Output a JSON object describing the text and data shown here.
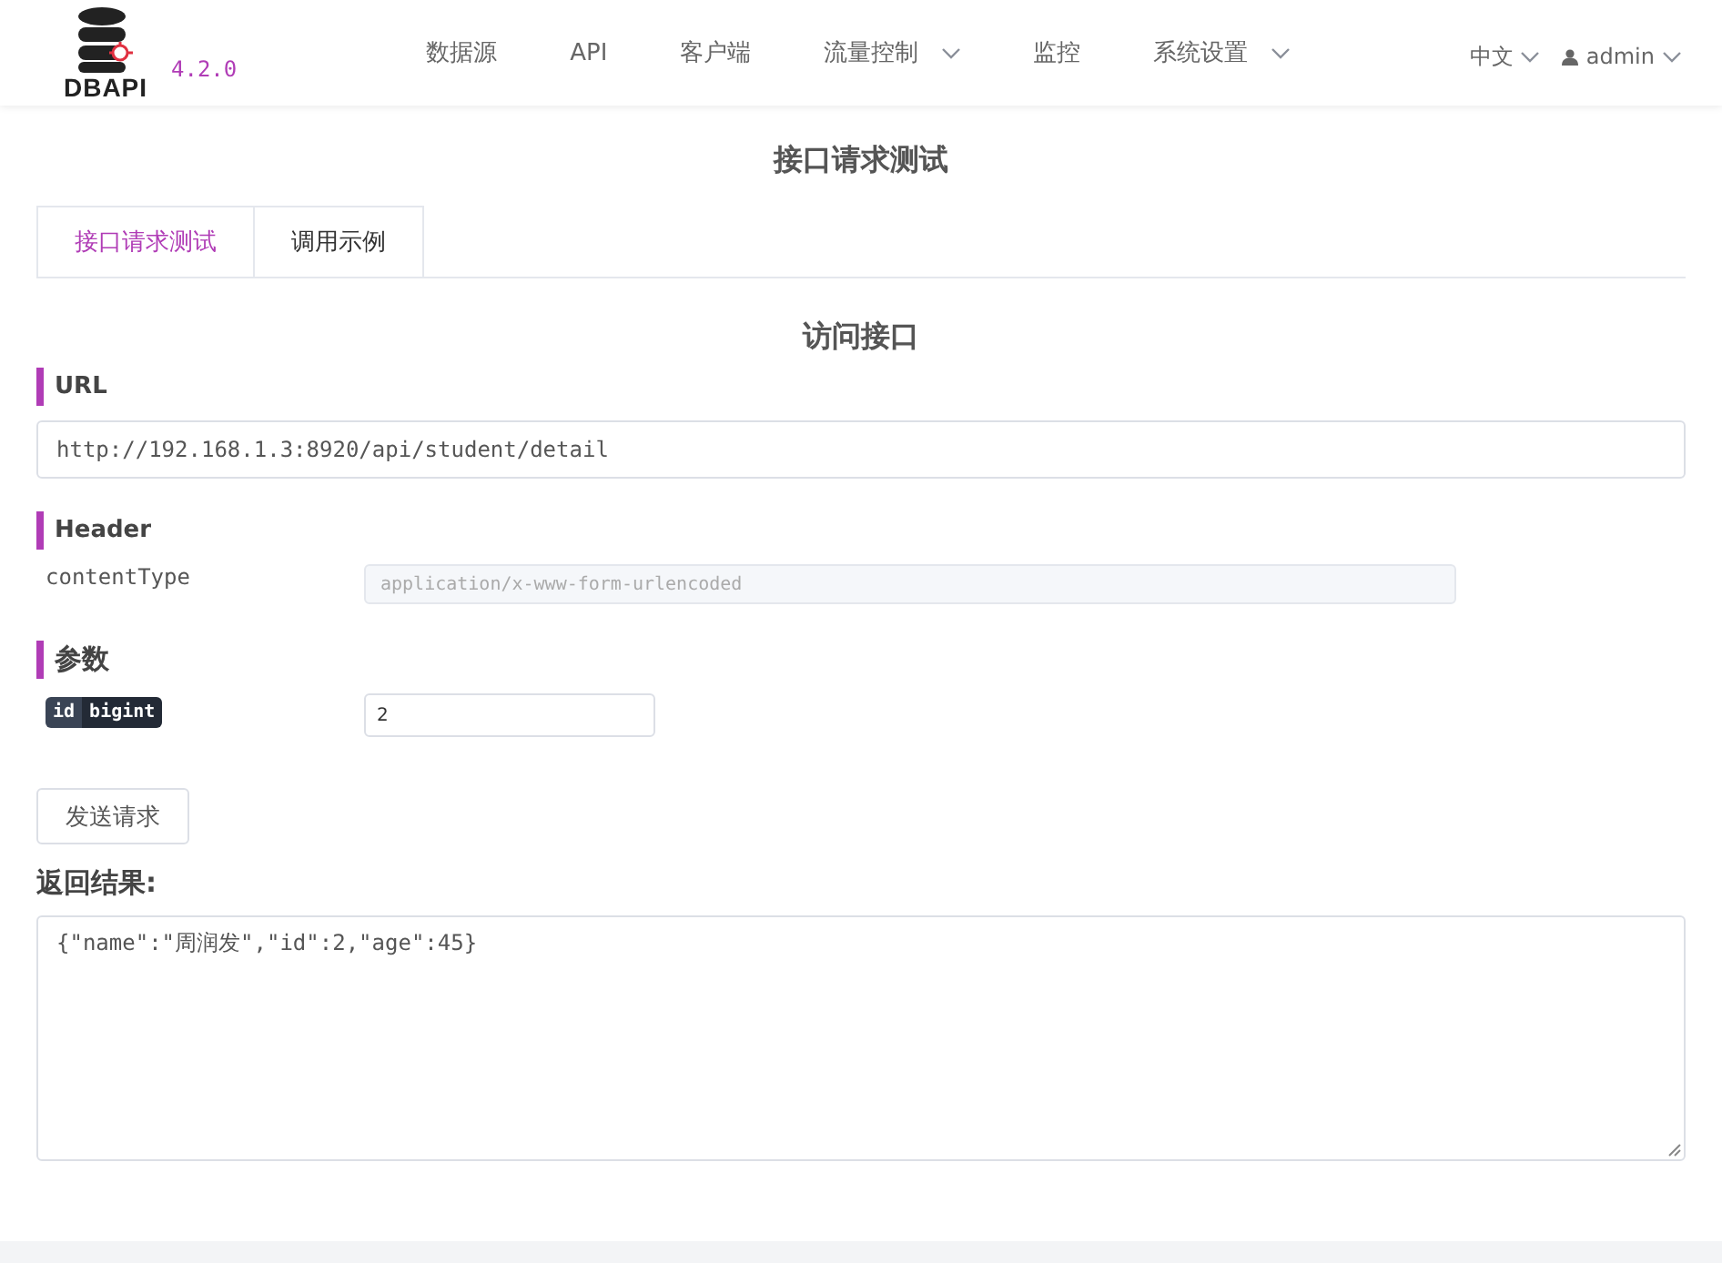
{
  "header": {
    "logo_text": "DBAPI",
    "version": "4.2.0",
    "nav": [
      {
        "label": "数据源",
        "dropdown": false
      },
      {
        "label": "API",
        "dropdown": false
      },
      {
        "label": "客户端",
        "dropdown": false
      },
      {
        "label": "流量控制",
        "dropdown": true
      },
      {
        "label": "监控",
        "dropdown": false
      },
      {
        "label": "系统设置",
        "dropdown": true
      }
    ],
    "language": "中文",
    "user": "admin"
  },
  "page_title": "接口请求测试",
  "tabs": [
    {
      "label": "接口请求测试",
      "selected": true
    },
    {
      "label": "调用示例",
      "selected": false
    }
  ],
  "section_title": "访问接口",
  "url": {
    "label": "URL",
    "value": "http://192.168.1.3:8920/api/student/detail"
  },
  "header_section": {
    "label": "Header",
    "rows": [
      {
        "name": "contentType",
        "value": "application/x-www-form-urlencoded",
        "disabled": true
      }
    ]
  },
  "params": {
    "label": "参数",
    "rows": [
      {
        "name": "id",
        "type": "bigint",
        "value": "2"
      }
    ]
  },
  "send_button": "发送请求",
  "result": {
    "label": "返回结果:",
    "value": "{\"name\":\"周润发\",\"id\":2,\"age\":45}"
  }
}
